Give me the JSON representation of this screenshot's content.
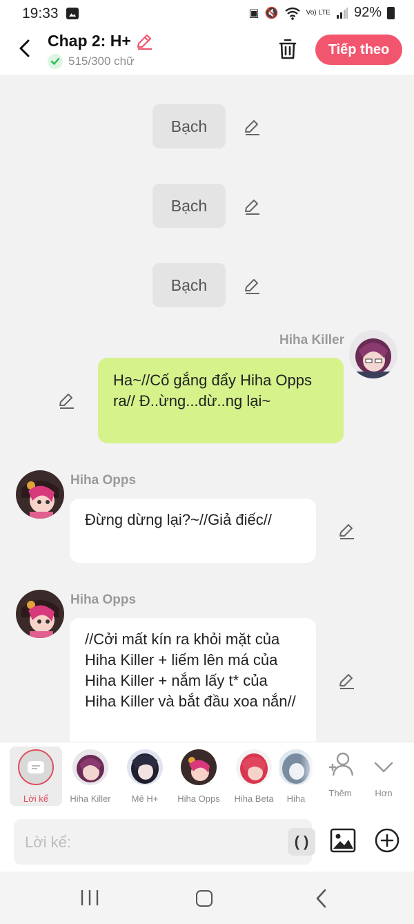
{
  "status_bar": {
    "time": "19:33",
    "battery": "92%",
    "network": "Vo) LTE"
  },
  "header": {
    "title": "Chap 2: H+",
    "word_count": "515/300 chữ",
    "next_button": "Tiếp theo",
    "accent_color": "#f2566e"
  },
  "chat": {
    "narration_messages": [
      "Bạch",
      "Bạch",
      "Bạch"
    ],
    "messages": [
      {
        "sender": "Hiha Killer",
        "side": "right",
        "text": "Ha~//Cố gắng đẩy Hiha Opps ra// Đ..ừng...dừ..ng lại~"
      },
      {
        "sender": "Hiha Opps",
        "side": "left",
        "text": "Đừng dừng lại?~//Giả điếc//"
      },
      {
        "sender": "Hiha Opps",
        "side": "left",
        "text": "//Cởi mất kín ra khỏi mặt của Hiha Killer + liếm lên má của Hiha Killer + nắm lấy t* của Hiha Killer và bắt đầu xoa nắn//"
      }
    ]
  },
  "character_bar": {
    "items": [
      {
        "label": "Lời kể",
        "selected": true
      },
      {
        "label": "Hiha Killer"
      },
      {
        "label": "Mê H+"
      },
      {
        "label": "Hiha Opps"
      },
      {
        "label": "Hiha Beta"
      },
      {
        "label": "Hiha"
      }
    ],
    "add_label": "Thêm",
    "more_label": "Hơn"
  },
  "input": {
    "placeholder": "Lời kể:",
    "paren_button": "( )"
  }
}
